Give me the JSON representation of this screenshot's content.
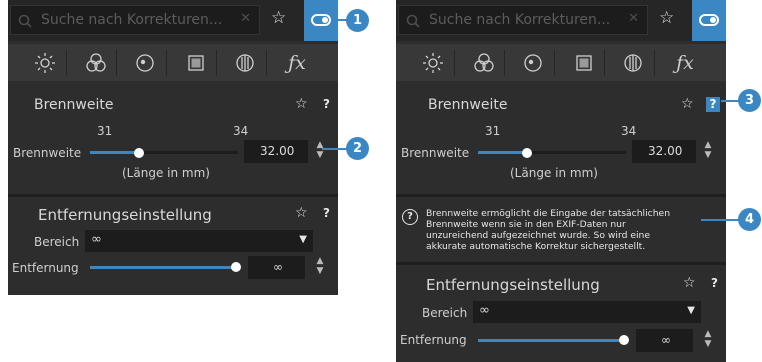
{
  "panels": [
    {
      "search_placeholder": "Suche nach Korrekturen...",
      "tool_icons": [
        "sun-icon",
        "color-circles-icon",
        "lens-dot-icon",
        "frame-icon",
        "split-circle-icon",
        "fx-icon"
      ],
      "section1_title": "Brennweite",
      "min_label": "31",
      "max_label": "34",
      "slider_label": "Brennweite",
      "value": "32.00",
      "caption": "(Länge in mm)",
      "section2_title": "Entfernungseinstellung",
      "range_label": "Bereich",
      "range_value": "∞",
      "distance_label": "Entfernung",
      "distance_value": "∞",
      "star": "☆",
      "help": "?"
    },
    {
      "search_placeholder": "Suche nach Korrekturen...",
      "tool_icons": [
        "sun-icon",
        "color-circles-icon",
        "lens-dot-icon",
        "frame-icon",
        "split-circle-icon",
        "fx-icon"
      ],
      "section1_title": "Brennweite",
      "min_label": "31",
      "max_label": "34",
      "slider_label": "Brennweite",
      "value": "32.00",
      "caption": "(Länge in mm)",
      "help_text": [
        "Brennweite ermöglicht die Eingabe der tatsächlichen",
        "Brennweite wenn sie in den EXIF-Daten nur",
        "unzureichend aufgezeichnet wurde. So wird eine",
        "akkurate automatische Korrektur sichergestellt."
      ],
      "section2_title": "Entfernungseinstellung",
      "range_label": "Bereich",
      "range_value": "∞",
      "distance_label": "Entfernung",
      "distance_value": "∞",
      "star": "☆",
      "help": "?"
    }
  ],
  "callouts": [
    "1",
    "2",
    "3",
    "4"
  ],
  "controls": {
    "focal_slider_fraction": 0.33,
    "distance_slider_fraction": 1.0
  },
  "colors": {
    "accent": "#3a87c4",
    "panel_bg": "#2d2d2d",
    "field_bg": "#1c1c1c"
  }
}
